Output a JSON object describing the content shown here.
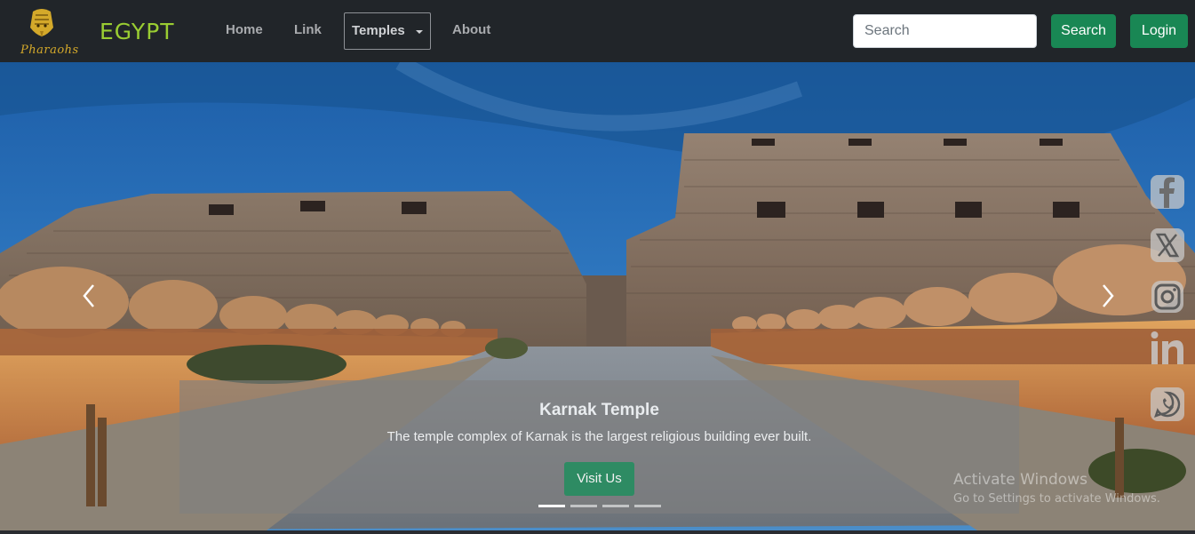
{
  "navbar": {
    "logo_text": "Pharaohs",
    "brand": "EGYPT",
    "links": {
      "home": "Home",
      "link": "Link",
      "temples": "Temples",
      "about": "About"
    },
    "search": {
      "placeholder": "Search",
      "value": ""
    },
    "search_button": "Search",
    "login_button": "Login"
  },
  "carousel": {
    "slide": {
      "title": "Karnak Temple",
      "text": "The temple complex of Karnak is the largest religious building ever built.",
      "button": "Visit Us"
    },
    "indicators": [
      {
        "active": true
      },
      {
        "active": false
      },
      {
        "active": false
      },
      {
        "active": false
      }
    ],
    "prev_icon": "chevron-left-icon",
    "next_icon": "chevron-right-icon"
  },
  "social_icons": [
    "facebook-icon",
    "x-twitter-icon",
    "instagram-icon",
    "linkedin-icon",
    "whatsapp-icon"
  ],
  "watermark": {
    "line1": "Activate Windows",
    "line2": "Go to Settings to activate Windows."
  },
  "colors": {
    "navbar_bg": "#212529",
    "brand": "#9acd32",
    "button_green": "#198754",
    "sky": "#2f6fb5"
  }
}
